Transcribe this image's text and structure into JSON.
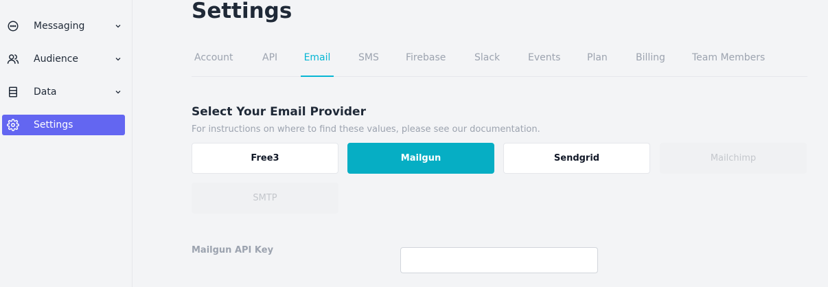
{
  "sidebar": {
    "items": [
      {
        "label": "Messaging",
        "icon": "chat-bubble-icon",
        "has_chevron": true
      },
      {
        "label": "Audience",
        "icon": "users-icon",
        "has_chevron": true
      },
      {
        "label": "Data",
        "icon": "database-icon",
        "has_chevron": true
      },
      {
        "label": "Settings",
        "icon": "gear-icon",
        "active": true
      }
    ]
  },
  "page": {
    "title": "Settings"
  },
  "tabs": [
    {
      "label": "Account"
    },
    {
      "label": "API"
    },
    {
      "label": "Email",
      "active": true
    },
    {
      "label": "SMS"
    },
    {
      "label": "Firebase"
    },
    {
      "label": "Slack"
    },
    {
      "label": "Events"
    },
    {
      "label": "Plan"
    },
    {
      "label": "Billing"
    },
    {
      "label": "Team Members"
    }
  ],
  "email": {
    "title": "Select Your Email Provider",
    "subtitle": "For instructions on where to find these values, please see our documentation.",
    "providers": [
      {
        "label": "Free3",
        "state": "enabled"
      },
      {
        "label": "Mailgun",
        "state": "selected"
      },
      {
        "label": "Sendgrid",
        "state": "enabled"
      },
      {
        "label": "Mailchimp",
        "state": "disabled"
      },
      {
        "label": "SMTP",
        "state": "disabled"
      }
    ],
    "api_key_label": "Mailgun API Key",
    "api_key_value": "",
    "api_key_placeholder": ""
  },
  "colors": {
    "accent": "#06b6d4",
    "selected_provider": "#06aec4",
    "sidebar_active": "#6366f1"
  }
}
